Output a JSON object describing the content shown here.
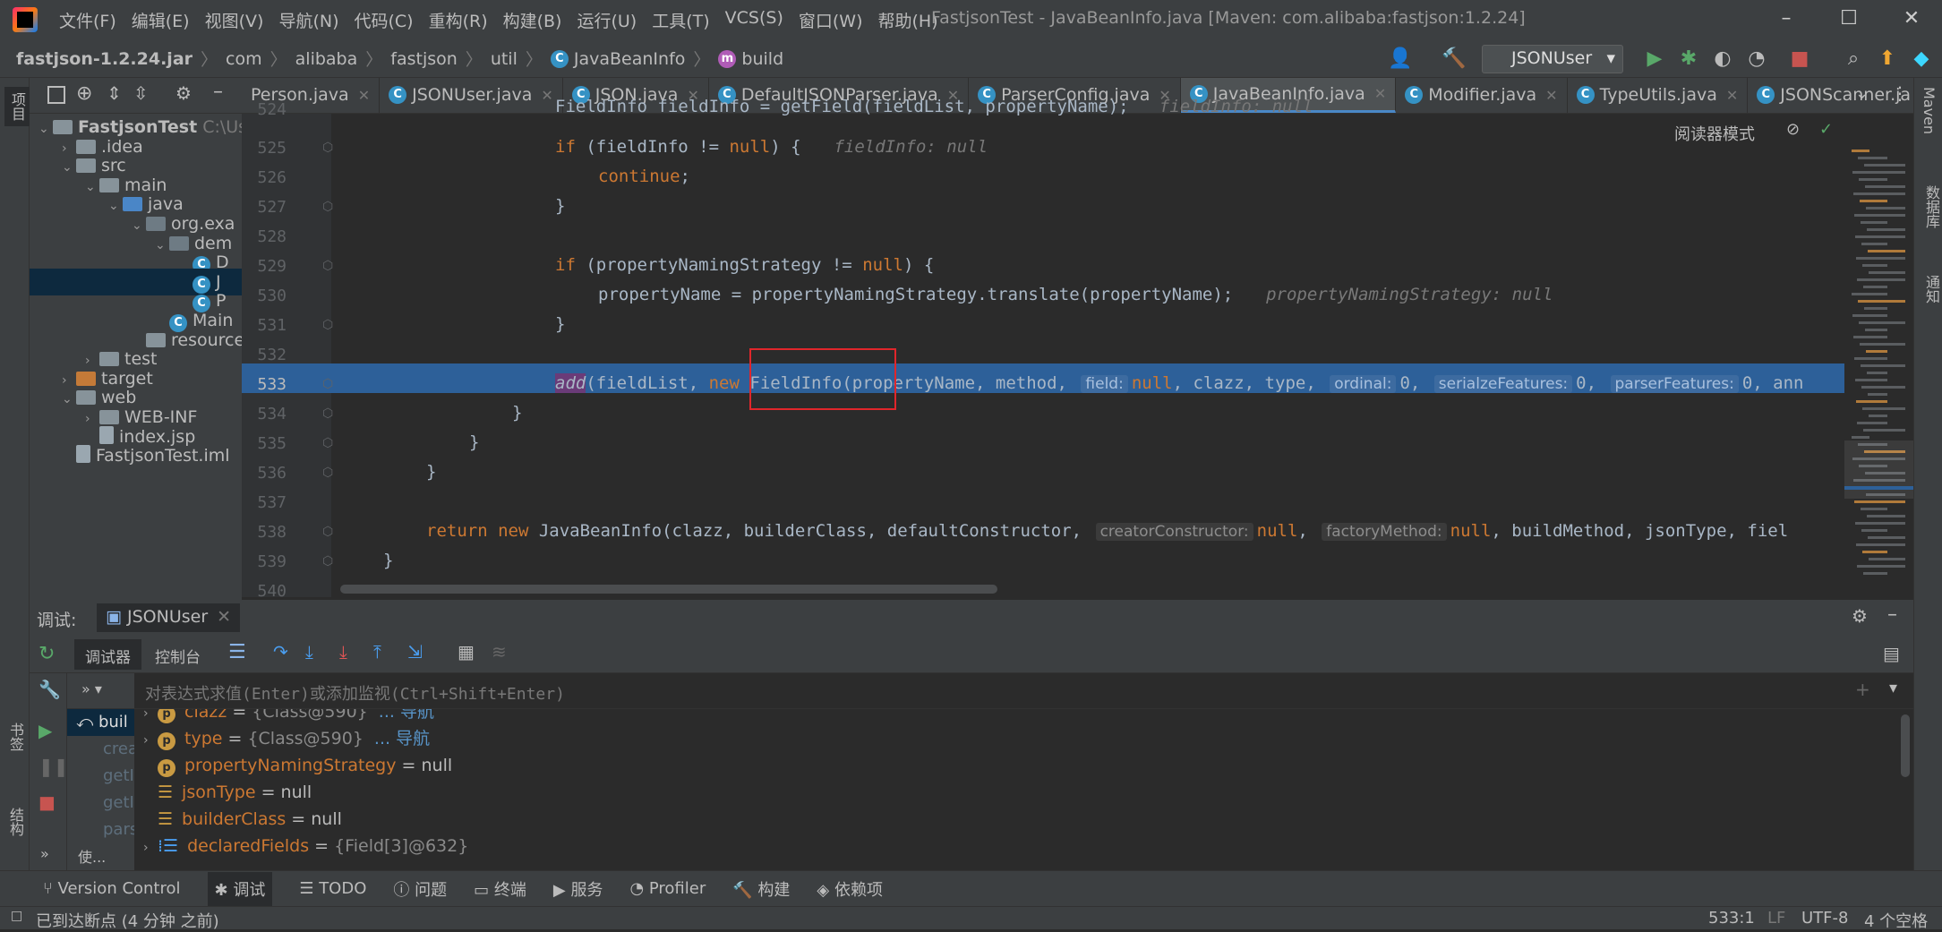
{
  "menu": [
    "文件(F)",
    "编辑(E)",
    "视图(V)",
    "导航(N)",
    "代码(C)",
    "重构(R)",
    "构建(B)",
    "运行(U)",
    "工具(T)",
    "VCS(S)",
    "窗口(W)",
    "帮助(H)"
  ],
  "window_title": "FastjsonTest - JavaBeanInfo.java [Maven: com.alibaba:fastjson:1.2.24]",
  "breadcrumb": [
    "fastjson-1.2.24.jar",
    "com",
    "alibaba",
    "fastjson",
    "util",
    "JavaBeanInfo",
    "build"
  ],
  "run_config": "JSONUser",
  "project": {
    "tree": [
      {
        "label": "FastjsonTest",
        "suffix": "C:\\Use",
        "depth": 0,
        "expanded": true,
        "kind": "module"
      },
      {
        "label": ".idea",
        "depth": 1,
        "expanded": false,
        "kind": "folder"
      },
      {
        "label": "src",
        "depth": 1,
        "expanded": true,
        "kind": "folder"
      },
      {
        "label": "main",
        "depth": 2,
        "expanded": true,
        "kind": "folder"
      },
      {
        "label": "java",
        "depth": 3,
        "expanded": true,
        "kind": "folder-blue"
      },
      {
        "label": "org.exa",
        "depth": 4,
        "expanded": true,
        "kind": "package"
      },
      {
        "label": "dem",
        "depth": 5,
        "expanded": true,
        "kind": "package"
      },
      {
        "label": "D",
        "depth": 6,
        "kind": "class"
      },
      {
        "label": "J",
        "depth": 6,
        "kind": "class",
        "selected": true
      },
      {
        "label": "P",
        "depth": 6,
        "kind": "class"
      },
      {
        "label": "Main",
        "depth": 5,
        "kind": "class"
      },
      {
        "label": "resources",
        "depth": 4,
        "kind": "folder"
      },
      {
        "label": "test",
        "depth": 2,
        "expanded": false,
        "kind": "folder"
      },
      {
        "label": "target",
        "depth": 1,
        "expanded": false,
        "kind": "folder-orange"
      },
      {
        "label": "web",
        "depth": 1,
        "expanded": true,
        "kind": "folder"
      },
      {
        "label": "WEB-INF",
        "depth": 2,
        "expanded": false,
        "kind": "folder"
      },
      {
        "label": "index.jsp",
        "depth": 2,
        "kind": "file"
      },
      {
        "label": "FastjsonTest.iml",
        "depth": 1,
        "kind": "file"
      }
    ]
  },
  "editor_tabs": [
    {
      "label": "Person.java",
      "active": false
    },
    {
      "label": "JSONUser.java",
      "active": false
    },
    {
      "label": "JSON.java",
      "active": false
    },
    {
      "label": "DefaultJSONParser.java",
      "active": false
    },
    {
      "label": "ParserConfig.java",
      "active": false
    },
    {
      "label": "JavaBeanInfo.java",
      "active": true
    },
    {
      "label": "Modifier.java",
      "active": false
    },
    {
      "label": "TypeUtils.java",
      "active": false
    },
    {
      "label": "JSONScanner.ja",
      "active": false
    }
  ],
  "reader_mode": "阅读器模式",
  "code_lines": [
    {
      "n": "524",
      "text": "FieldInfo fieldInfo = getField(fieldList, propertyName);"
    },
    {
      "n": "525",
      "text": "if (fieldInfo != null) {",
      "hint": "fieldInfo: null"
    },
    {
      "n": "526",
      "text": "continue;"
    },
    {
      "n": "527",
      "text": "}"
    },
    {
      "n": "528",
      "text": ""
    },
    {
      "n": "529",
      "text": "if (propertyNamingStrategy != null) {"
    },
    {
      "n": "530",
      "text": "propertyName = propertyNamingStrategy.translate(propertyName);",
      "hint": "propertyNamingStrategy: null"
    },
    {
      "n": "531",
      "text": "}"
    },
    {
      "n": "532",
      "text": ""
    },
    {
      "n": "533",
      "text": "add(fieldList, new FieldInfo(propertyName, method,"
    },
    {
      "n": "534",
      "text": "}"
    },
    {
      "n": "535",
      "text": "}"
    },
    {
      "n": "536",
      "text": "}"
    },
    {
      "n": "537",
      "text": ""
    },
    {
      "n": "538",
      "text": "return new JavaBeanInfo(clazz, builderClass, defaultConstructor,"
    },
    {
      "n": "539",
      "text": "}"
    },
    {
      "n": "540",
      "text": ""
    }
  ],
  "inline_hints": {
    "field": "field:",
    "ordinal": "ordinal:",
    "serialize": "serialzeFeatures:",
    "parser": "parserFeatures:",
    "creator": "creatorConstructor:",
    "factory": "factoryMethod:"
  },
  "debug": {
    "label": "调试:",
    "session": "JSONUser",
    "tab_debugger": "调试器",
    "tab_console": "控制台",
    "expr_placeholder": "对表达式求值(Enter)或添加监视(Ctrl+Shift+Enter)",
    "frames": [
      "buil",
      "crea",
      "getI",
      "getI",
      "pars"
    ],
    "frames_more": "使...",
    "variables": [
      {
        "name": "clazz",
        "value": "{Class@590}",
        "link": "... 导航",
        "icon": "p",
        "expandable": true
      },
      {
        "name": "type",
        "value": "{Class@590}",
        "link": "... 导航",
        "icon": "p",
        "expandable": true
      },
      {
        "name": "propertyNamingStrategy",
        "value": "null",
        "icon": "p",
        "expandable": false
      },
      {
        "name": "jsonType",
        "value": "null",
        "icon": "list",
        "expandable": false
      },
      {
        "name": "builderClass",
        "value": "null",
        "icon": "list",
        "expandable": false
      },
      {
        "name": "declaredFields",
        "value": "{Field[3]@632}",
        "icon": "arr",
        "expandable": true
      }
    ]
  },
  "bottom_tools": [
    "Version Control",
    "调试",
    "TODO",
    "问题",
    "终端",
    "服务",
    "Profiler",
    "构建",
    "依赖项"
  ],
  "status": {
    "message": "已到达断点 (4 分钟 之前)",
    "position": "533:1",
    "line_sep": "LF",
    "encoding": "UTF-8",
    "indent": "4 个空格"
  },
  "side_labels": {
    "project": "项目",
    "bookmarks": "书签",
    "structure": "结构",
    "maven": "Maven",
    "database": "数据库",
    "notifications": "通知"
  }
}
